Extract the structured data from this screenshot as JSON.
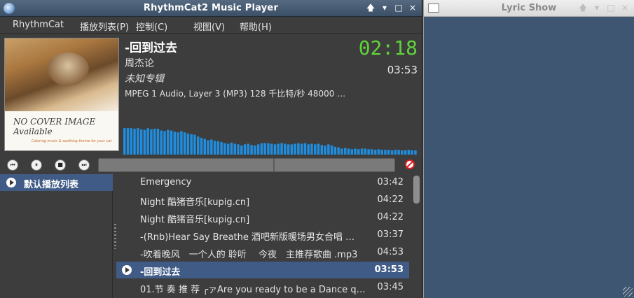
{
  "player": {
    "title": "RhythmCat2 Music Player",
    "window_buttons": [
      "🡅",
      "▾",
      "□",
      "×"
    ],
    "menu": [
      "RhythmCat",
      "播放列表(P)",
      "控制(C)",
      "视图(V)",
      "帮助(H)"
    ],
    "cover": {
      "line1": "NO COVER IMAGE",
      "line2": "Available",
      "tagline": "Coloring music & soothing theme for your cat"
    },
    "track": {
      "title": "-回到过去",
      "artist": "周杰论",
      "album": "未知专辑",
      "format": "MPEG 1 Audio, Layer 3 (MP3) 128 千比特/秒 48000 …",
      "elapsed": "02:18",
      "total": "03:53"
    },
    "spectrum_levels": [
      0.88,
      0.88,
      0.88,
      0.86,
      0.88,
      0.84,
      0.82,
      0.88,
      0.84,
      0.86,
      0.86,
      0.8,
      0.78,
      0.82,
      0.8,
      0.76,
      0.74,
      0.78,
      0.74,
      0.7,
      0.68,
      0.66,
      0.6,
      0.56,
      0.52,
      0.48,
      0.5,
      0.46,
      0.44,
      0.42,
      0.38,
      0.36,
      0.4,
      0.36,
      0.34,
      0.3,
      0.34,
      0.36,
      0.32,
      0.3,
      0.34,
      0.38,
      0.38,
      0.38,
      0.36,
      0.34,
      0.36,
      0.38,
      0.36,
      0.34,
      0.34,
      0.36,
      0.38,
      0.36,
      0.38,
      0.34,
      0.36,
      0.34,
      0.36,
      0.32,
      0.3,
      0.34,
      0.3,
      0.26,
      0.24,
      0.2,
      0.22,
      0.2,
      0.18,
      0.2,
      0.18,
      0.2,
      0.2,
      0.18,
      0.18,
      0.16,
      0.18,
      0.16,
      0.16,
      0.16,
      0.14,
      0.16,
      0.16,
      0.14,
      0.14,
      0.16,
      0.14,
      0.14
    ],
    "progress": 0.59,
    "playlists": [
      {
        "label": "默认播放列表",
        "selected": true
      }
    ],
    "tracks": [
      {
        "name": " Emergency",
        "duration": "03:42",
        "playing": false
      },
      {
        "name": "Night 酷猪音乐[kupig.cn]",
        "duration": "04:22",
        "playing": false
      },
      {
        "name": "Night 酷猪音乐[kupig.cn]",
        "duration": "04:22",
        "playing": false
      },
      {
        "name": "-(Rnb)Hear Say Breathe 酒吧新版暖场男女合唱 …",
        "duration": "03:37",
        "playing": false
      },
      {
        "name": "-吹着晚风　一个人的 聆听　 今夜　主推荐歌曲 .mp3",
        "duration": "04:53",
        "playing": false
      },
      {
        "name": "-回到过去",
        "duration": "03:53",
        "playing": true
      },
      {
        "name": "01.节 奏 推 荐 ╭ァAre you ready to be a Dance q…",
        "duration": "03:45",
        "playing": false
      }
    ]
  },
  "lyric": {
    "title": "Lyric Show",
    "window_buttons": [
      "🡅",
      "▾",
      "□",
      "×"
    ]
  }
}
